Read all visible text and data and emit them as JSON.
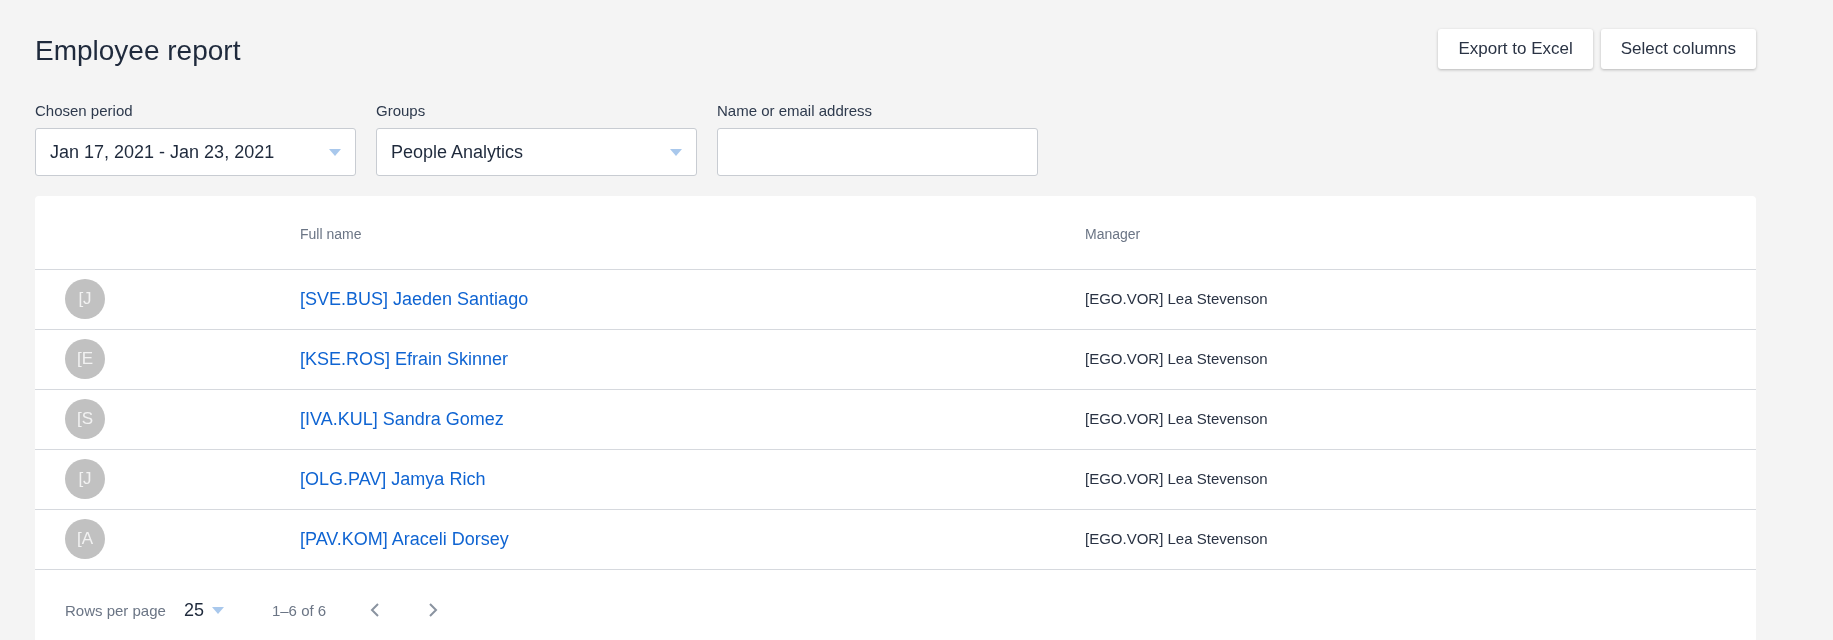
{
  "title": "Employee report",
  "buttons": [
    "Export to Excel",
    "Select columns"
  ],
  "filters": [
    {
      "kind": "dropdown",
      "label": "Chosen period",
      "value": "Jan 17, 2021 - Jan 23, 2021"
    },
    {
      "kind": "dropdown",
      "label": "Groups",
      "value": "People Analytics"
    },
    {
      "kind": "text",
      "label": "Name or email address"
    }
  ],
  "table": {
    "columns": [
      "Full name",
      "Manager"
    ],
    "rows": [
      {
        "avatar": "[J",
        "name": "[SVE.BUS] Jaeden Santiago",
        "manager": "[EGO.VOR] Lea Stevenson"
      },
      {
        "avatar": "[E",
        "name": "[KSE.ROS] Efrain Skinner",
        "manager": "[EGO.VOR] Lea Stevenson"
      },
      {
        "avatar": "[S",
        "name": "[IVA.KUL] Sandra Gomez",
        "manager": "[EGO.VOR] Lea Stevenson"
      },
      {
        "avatar": "[J",
        "name": "[OLG.PAV] Jamya Rich",
        "manager": "[EGO.VOR] Lea Stevenson"
      },
      {
        "avatar": "[A",
        "name": "[PAV.KOM] Araceli Dorsey",
        "manager": "[EGO.VOR] Lea Stevenson"
      }
    ]
  },
  "pagination": {
    "rows_per_page_label": "Rows per page",
    "rows_per_page": "25",
    "range": "1–6 of 6"
  }
}
